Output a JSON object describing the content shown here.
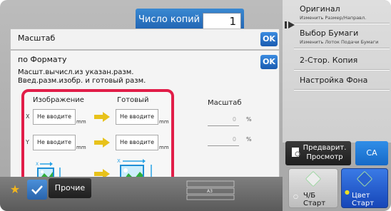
{
  "header": {
    "copies_label": "Число копий",
    "copies_value": "1"
  },
  "right_panel": {
    "items": [
      {
        "label": "Оригинал",
        "sub": "Изменить Размер/Направл."
      },
      {
        "label": "Выбор Бумаги",
        "sub": "Изменить Лоток Подачи Бумаги"
      },
      {
        "label": "2-Стор. Копия",
        "sub": ""
      },
      {
        "label": "Настройка Фона",
        "sub": ""
      }
    ]
  },
  "dialog_scale": {
    "title": "Масштаб",
    "ok_label": "OK"
  },
  "dialog_by_format": {
    "title": "по Формату",
    "ok_label": "OK",
    "description_line1": "Масшт.вычисл.из указан.разм.",
    "description_line2": "Введ.разм.изобр. и готовый разм.",
    "image_header": "Изображение",
    "ready_header": "Готовый",
    "axis_x": "X",
    "axis_y": "Y",
    "placeholder": "Не вводите",
    "unit": "mm",
    "scale_header": "Масштаб",
    "scale_x_value": "0",
    "scale_y_value": "0",
    "percent": "%"
  },
  "bottom": {
    "other_label": "Прочие",
    "preview_line1": "Предварит.",
    "preview_line2": "Просмотр",
    "ca_label": "CA",
    "bw_line1": "Ч/Б",
    "bw_line2": "Старт",
    "color_line1": "Цвет",
    "color_line2": "Старт",
    "mini_label": "A3"
  },
  "colors": {
    "accent_blue": "#1d5fae",
    "highlight_red": "#e11d48",
    "arrow_yellow": "#e8c21b",
    "star_gold": "#f2b51d"
  }
}
